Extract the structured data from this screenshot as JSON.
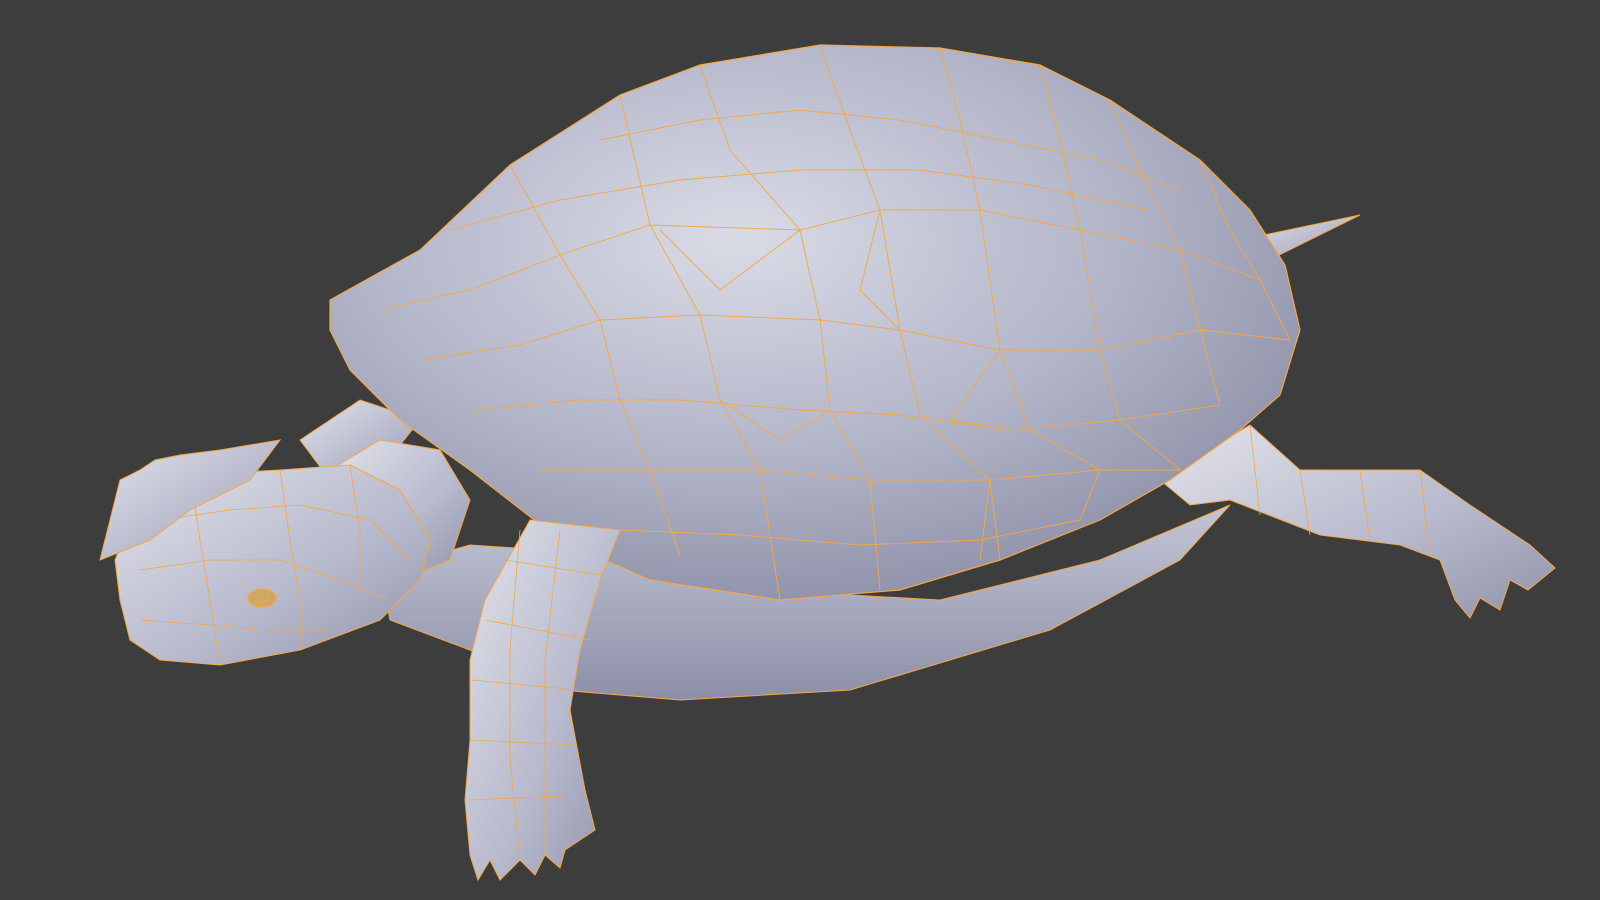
{
  "viewport": {
    "background_color": "#3d3d3d",
    "mode": "edit-mode-wireframe-overlay"
  },
  "model": {
    "subject": "turtle",
    "shading": "solid",
    "surface_color": "#b8bbd0",
    "wire_color": "#f5a742",
    "selected": true
  }
}
